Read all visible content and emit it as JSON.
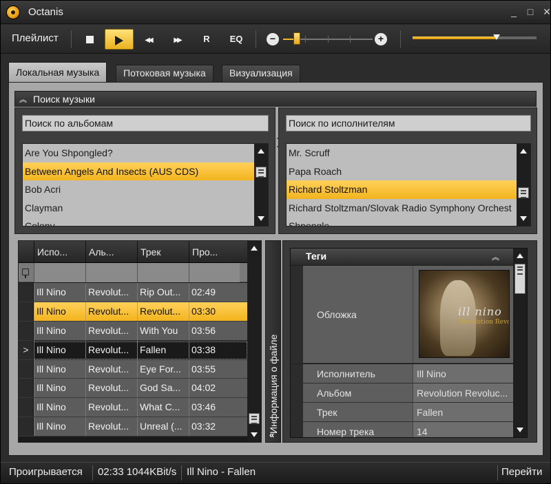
{
  "window": {
    "title": "Octanis",
    "minimize": "_",
    "maximize": "□",
    "close": "✕"
  },
  "toolbar": {
    "playlist_label": "Плейлист",
    "repeat_label": "R",
    "eq_label": "EQ",
    "prev_glyph": "◀◀",
    "next_glyph": "▶▶",
    "volume_minus": "−",
    "volume_plus": "+",
    "volume_level": 0.15,
    "position_level": 0.68,
    "accent": "#f3b41e"
  },
  "tabs": [
    {
      "label": "Локальная музыка",
      "active": true
    },
    {
      "label": "Потоковая музыка",
      "active": false
    },
    {
      "label": "Визуализация",
      "active": false
    }
  ],
  "search": {
    "title": "Поиск музыки",
    "albums_box": "Поиск по альбомам",
    "artists_box": "Поиск по исполнителям",
    "albums": [
      "Are You Shpongled?",
      "Between Angels And Insects (AUS CDS)",
      "Bob Acri",
      "Clayman",
      "Colony"
    ],
    "albums_selected": 1,
    "artists": [
      "Mr. Scruff",
      "Papa Roach",
      "Richard Stoltzman",
      "Richard Stoltzman/Slovak Radio Symphony Orchest",
      "Shpongle"
    ],
    "artists_selected": 2
  },
  "grid": {
    "columns": [
      "Испо...",
      "Аль...",
      "Трек",
      "Про..."
    ],
    "rows": [
      {
        "marker": "",
        "artist": "Ill Nino",
        "album": "Revolut...",
        "track": "Rip Out...",
        "duration": "02:49",
        "state": "normal"
      },
      {
        "marker": "",
        "artist": "Ill Nino",
        "album": "Revolut...",
        "track": "Revolut...",
        "duration": "03:30",
        "state": "selected"
      },
      {
        "marker": "",
        "artist": "Ill Nino",
        "album": "Revolut...",
        "track": "With You",
        "duration": "03:56",
        "state": "normal"
      },
      {
        "marker": ">",
        "artist": "Ill Nino",
        "album": "Revolut...",
        "track": "Fallen",
        "duration": "03:38",
        "state": "current"
      },
      {
        "marker": "",
        "artist": "Ill Nino",
        "album": "Revolut...",
        "track": "Eye For...",
        "duration": "03:55",
        "state": "normal"
      },
      {
        "marker": "",
        "artist": "Ill Nino",
        "album": "Revolut...",
        "track": "God Sa...",
        "duration": "04:02",
        "state": "normal"
      },
      {
        "marker": "",
        "artist": "Ill Nino",
        "album": "Revolut...",
        "track": "What C...",
        "duration": "03:46",
        "state": "normal"
      },
      {
        "marker": "",
        "artist": "Ill Nino",
        "album": "Revolut...",
        "track": "Unreal (...",
        "duration": "03:32",
        "state": "normal"
      }
    ]
  },
  "info": {
    "panel_label": "Информация о файле",
    "tags_title": "Теги",
    "cover_label": "Обложка",
    "cover_band": "ill nino",
    "cover_caption": "Revolution Revolution",
    "fields": [
      {
        "label": "Исполнитель",
        "value": "Ill Nino"
      },
      {
        "label": "Альбом",
        "value": "Revolution Revoluc..."
      },
      {
        "label": "Трек",
        "value": "Fallen"
      },
      {
        "label": "Номер трека",
        "value": "14"
      }
    ]
  },
  "status": {
    "state": "Проигрывается",
    "time_bitrate": "02:33 1044KBit/s",
    "now_playing": "Ill Nino - Fallen",
    "goto": "Перейти"
  }
}
